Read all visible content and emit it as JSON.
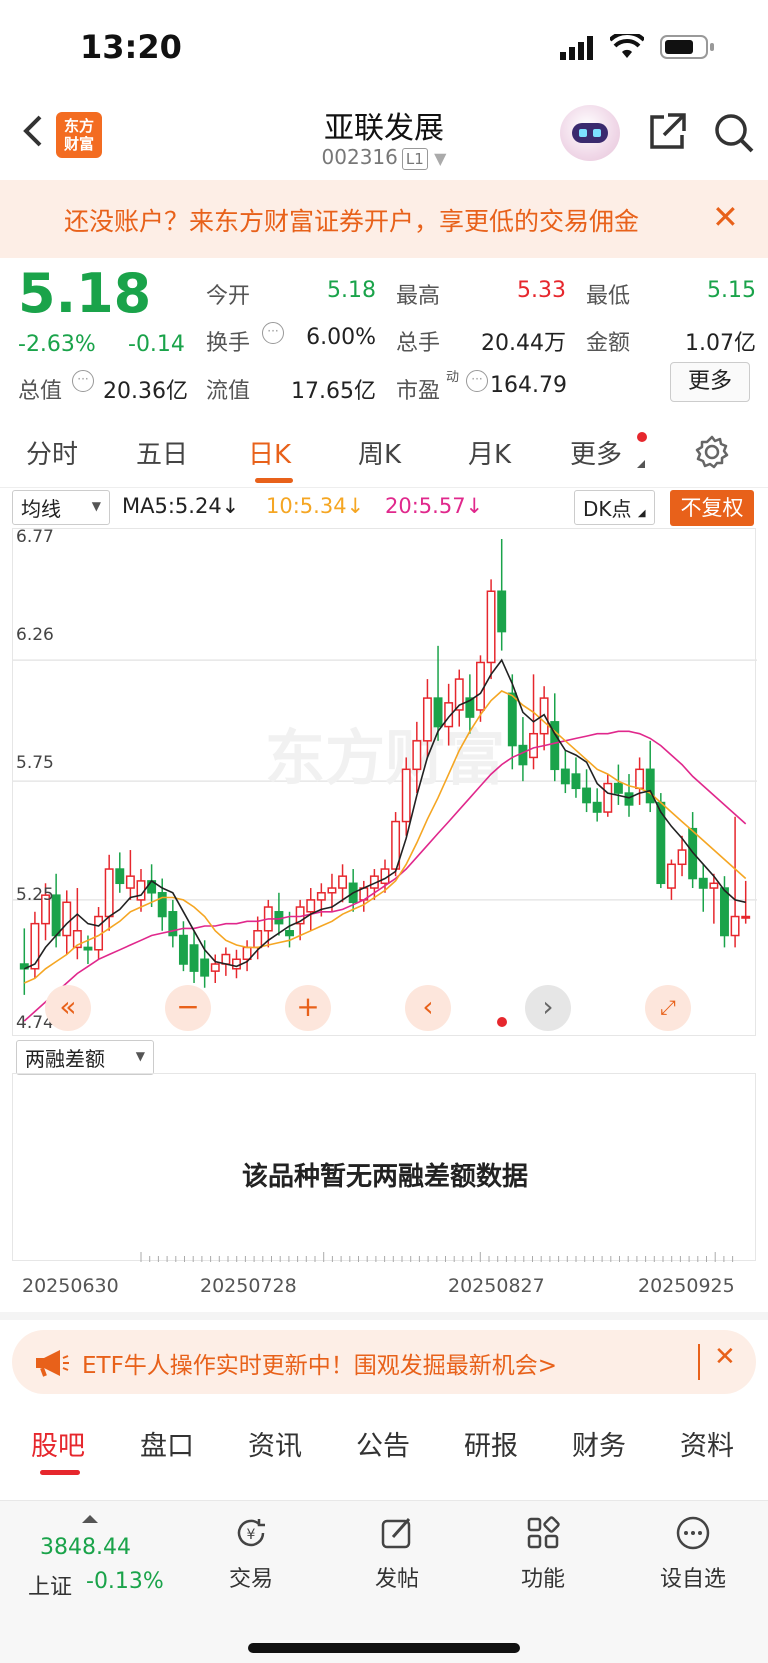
{
  "status_bar": {
    "time": "13:20"
  },
  "header": {
    "title": "亚联发展",
    "code": "002316",
    "level": "L1",
    "logo_text": "东方财富"
  },
  "banner": {
    "text": "还没账户？来东方财富证券开户，享更低的交易佣金"
  },
  "quote": {
    "price": "5.18",
    "change_pct": "-2.63%",
    "change": "-0.14",
    "fields": [
      {
        "label": "今开",
        "value": "5.18",
        "color": "green"
      },
      {
        "label": "最高",
        "value": "5.33",
        "color": "red"
      },
      {
        "label": "最低",
        "value": "5.15",
        "color": "green"
      },
      {
        "label": "换手",
        "value": "6.00%",
        "color": "normal"
      },
      {
        "label": "总手",
        "value": "20.44万",
        "color": "normal"
      },
      {
        "label": "金额",
        "value": "1.07亿",
        "color": "normal"
      },
      {
        "label": "总值",
        "value": "20.36亿",
        "color": "normal"
      },
      {
        "label": "流值",
        "value": "17.65亿",
        "color": "normal"
      },
      {
        "label": "市盈",
        "sup": "动",
        "value": "164.79",
        "color": "normal"
      }
    ],
    "more_label": "更多"
  },
  "period_tabs": [
    {
      "label": "分时"
    },
    {
      "label": "五日"
    },
    {
      "label": "日K",
      "active": true
    },
    {
      "label": "周K"
    },
    {
      "label": "月K"
    },
    {
      "label": "更多"
    }
  ],
  "ma_bar": {
    "select": "均线",
    "ma5": "MA5:5.24↓",
    "ma10": "10:5.34↓",
    "ma20": "20:5.57↓",
    "dk": "DK点",
    "adjust": "不复权",
    "colors": {
      "ma5": "#222222",
      "ma10": "#f5a623",
      "ma20": "#e0288c"
    }
  },
  "chart_data": {
    "type": "candlestick",
    "y_ticks": [
      "6.77",
      "6.26",
      "5.75",
      "5.25",
      "4.74"
    ],
    "ylim": [
      4.74,
      6.77
    ],
    "grid": true,
    "watermark": "东方财富",
    "note": "approximate daily OHLC read from chart",
    "ohlc": [
      [
        4.98,
        5.13,
        4.85,
        4.96
      ],
      [
        4.96,
        5.2,
        4.92,
        5.15
      ],
      [
        5.15,
        5.32,
        5.08,
        5.27
      ],
      [
        5.27,
        5.36,
        5.05,
        5.1
      ],
      [
        5.1,
        5.29,
        5.02,
        5.24
      ],
      [
        5.05,
        5.3,
        5.0,
        5.12
      ],
      [
        5.05,
        5.1,
        4.98,
        5.04
      ],
      [
        5.04,
        5.22,
        5.0,
        5.18
      ],
      [
        5.18,
        5.44,
        5.12,
        5.38
      ],
      [
        5.38,
        5.45,
        5.28,
        5.32
      ],
      [
        5.3,
        5.46,
        5.25,
        5.35
      ],
      [
        5.25,
        5.38,
        5.2,
        5.33
      ],
      [
        5.33,
        5.4,
        5.22,
        5.28
      ],
      [
        5.28,
        5.34,
        5.12,
        5.18
      ],
      [
        5.2,
        5.25,
        5.05,
        5.1
      ],
      [
        5.1,
        5.16,
        4.95,
        4.98
      ],
      [
        5.06,
        5.12,
        4.9,
        4.95
      ],
      [
        5.0,
        5.08,
        4.88,
        4.93
      ],
      [
        4.95,
        5.02,
        4.9,
        4.98
      ],
      [
        4.98,
        5.05,
        4.93,
        5.02
      ],
      [
        4.96,
        5.04,
        4.92,
        5.0
      ],
      [
        5.0,
        5.08,
        4.95,
        5.05
      ],
      [
        5.05,
        5.18,
        5.0,
        5.12
      ],
      [
        5.12,
        5.25,
        5.05,
        5.22
      ],
      [
        5.2,
        5.28,
        5.1,
        5.15
      ],
      [
        5.12,
        5.2,
        5.05,
        5.1
      ],
      [
        5.15,
        5.25,
        5.08,
        5.22
      ],
      [
        5.2,
        5.3,
        5.12,
        5.25
      ],
      [
        5.25,
        5.32,
        5.18,
        5.28
      ],
      [
        5.28,
        5.36,
        5.2,
        5.3
      ],
      [
        5.3,
        5.4,
        5.24,
        5.35
      ],
      [
        5.32,
        5.38,
        5.2,
        5.24
      ],
      [
        5.25,
        5.33,
        5.2,
        5.3
      ],
      [
        5.3,
        5.38,
        5.25,
        5.35
      ],
      [
        5.32,
        5.42,
        5.28,
        5.38
      ],
      [
        5.38,
        5.62,
        5.35,
        5.58
      ],
      [
        5.58,
        5.85,
        5.52,
        5.8
      ],
      [
        5.8,
        6.0,
        5.7,
        5.92
      ],
      [
        5.92,
        6.18,
        5.85,
        6.1
      ],
      [
        6.1,
        6.32,
        5.92,
        5.98
      ],
      [
        5.98,
        6.16,
        5.9,
        6.08
      ],
      [
        6.05,
        6.22,
        5.98,
        6.18
      ],
      [
        6.1,
        6.2,
        5.95,
        6.02
      ],
      [
        6.05,
        6.28,
        6.0,
        6.25
      ],
      [
        6.25,
        6.6,
        6.18,
        6.55
      ],
      [
        6.55,
        6.77,
        6.3,
        6.38
      ],
      [
        6.12,
        6.2,
        5.8,
        5.9
      ],
      [
        5.9,
        6.02,
        5.75,
        5.82
      ],
      [
        5.85,
        6.2,
        5.8,
        5.95
      ],
      [
        5.95,
        6.15,
        5.88,
        6.1
      ],
      [
        6.0,
        6.12,
        5.75,
        5.8
      ],
      [
        5.8,
        5.88,
        5.7,
        5.74
      ],
      [
        5.78,
        5.85,
        5.68,
        5.72
      ],
      [
        5.72,
        5.8,
        5.62,
        5.66
      ],
      [
        5.66,
        5.72,
        5.58,
        5.62
      ],
      [
        5.62,
        5.78,
        5.6,
        5.74
      ],
      [
        5.74,
        5.82,
        5.65,
        5.7
      ],
      [
        5.7,
        5.78,
        5.6,
        5.65
      ],
      [
        5.72,
        5.85,
        5.65,
        5.8
      ],
      [
        5.8,
        5.92,
        5.62,
        5.66
      ],
      [
        5.66,
        5.7,
        5.3,
        5.32
      ],
      [
        5.3,
        5.42,
        5.25,
        5.4
      ],
      [
        5.4,
        5.52,
        5.35,
        5.46
      ],
      [
        5.55,
        5.62,
        5.3,
        5.34
      ],
      [
        5.34,
        5.4,
        5.2,
        5.3
      ],
      [
        5.3,
        5.36,
        5.15,
        5.32
      ],
      [
        5.3,
        5.35,
        5.05,
        5.1
      ],
      [
        5.1,
        5.6,
        5.05,
        5.18
      ],
      [
        5.18,
        5.33,
        5.15,
        5.18
      ]
    ],
    "ma5": [
      4.96,
      4.98,
      5.05,
      5.1,
      5.15,
      5.19,
      5.15,
      5.14,
      5.18,
      5.21,
      5.26,
      5.27,
      5.33,
      5.3,
      5.28,
      5.2,
      5.12,
      5.04,
      4.99,
      4.98,
      4.97,
      4.99,
      5.04,
      5.08,
      5.11,
      5.14,
      5.16,
      5.19,
      5.21,
      5.22,
      5.25,
      5.28,
      5.3,
      5.32,
      5.34,
      5.37,
      5.51,
      5.69,
      5.85,
      5.96,
      6.02,
      6.07,
      6.09,
      6.12,
      6.2,
      6.26,
      6.16,
      6.04,
      6.0,
      6.03,
      5.95,
      5.88,
      5.86,
      5.83,
      5.74,
      5.7,
      5.69,
      5.68,
      5.7,
      5.71,
      5.62,
      5.56,
      5.51,
      5.45,
      5.4,
      5.35,
      5.29,
      5.25,
      5.24
    ],
    "ma10": [
      4.9,
      4.92,
      4.96,
      4.99,
      5.02,
      5.06,
      5.08,
      5.1,
      5.13,
      5.16,
      5.2,
      5.22,
      5.24,
      5.26,
      5.26,
      5.25,
      5.22,
      5.18,
      5.12,
      5.08,
      5.06,
      5.05,
      5.05,
      5.06,
      5.07,
      5.08,
      5.1,
      5.12,
      5.14,
      5.16,
      5.19,
      5.21,
      5.23,
      5.26,
      5.29,
      5.33,
      5.4,
      5.49,
      5.59,
      5.68,
      5.78,
      5.88,
      5.96,
      6.03,
      6.09,
      6.13,
      6.11,
      6.07,
      6.04,
      6.0,
      5.96,
      5.92,
      5.88,
      5.84,
      5.8,
      5.78,
      5.75,
      5.73,
      5.72,
      5.7,
      5.66,
      5.62,
      5.58,
      5.54,
      5.5,
      5.46,
      5.42,
      5.38,
      5.34
    ],
    "ma20": [
      4.74,
      4.78,
      4.82,
      4.86,
      4.9,
      4.94,
      4.97,
      5.0,
      5.02,
      5.04,
      5.06,
      5.08,
      5.1,
      5.11,
      5.12,
      5.13,
      5.13,
      5.14,
      5.14,
      5.15,
      5.15,
      5.16,
      5.16,
      5.17,
      5.17,
      5.18,
      5.18,
      5.19,
      5.2,
      5.2,
      5.21,
      5.23,
      5.25,
      5.28,
      5.31,
      5.34,
      5.38,
      5.43,
      5.48,
      5.53,
      5.58,
      5.63,
      5.68,
      5.73,
      5.78,
      5.82,
      5.85,
      5.87,
      5.89,
      5.9,
      5.91,
      5.92,
      5.93,
      5.94,
      5.95,
      5.95,
      5.96,
      5.96,
      5.95,
      5.93,
      5.9,
      5.86,
      5.82,
      5.77,
      5.73,
      5.69,
      5.65,
      5.61,
      5.57
    ]
  },
  "margin_panel": {
    "select": "两融差额",
    "empty_text": "该品种暂无两融差额数据"
  },
  "x_dates": [
    "20250630",
    "20250728",
    "20250827",
    "20250925"
  ],
  "etf_banner": {
    "text": "ETF牛人操作实时更新中！围观发掘最新机会>"
  },
  "bottom_tabs": [
    {
      "label": "股吧",
      "active": true
    },
    {
      "label": "盘口"
    },
    {
      "label": "资讯"
    },
    {
      "label": "公告"
    },
    {
      "label": "研报"
    },
    {
      "label": "财务"
    },
    {
      "label": "资料"
    }
  ],
  "bottom_nav": {
    "index_value": "3848.44",
    "index_name": "上证",
    "index_change": "-0.13%",
    "items": [
      {
        "label": "交易"
      },
      {
        "label": "发帖"
      },
      {
        "label": "功能"
      },
      {
        "label": "设自选"
      }
    ]
  }
}
